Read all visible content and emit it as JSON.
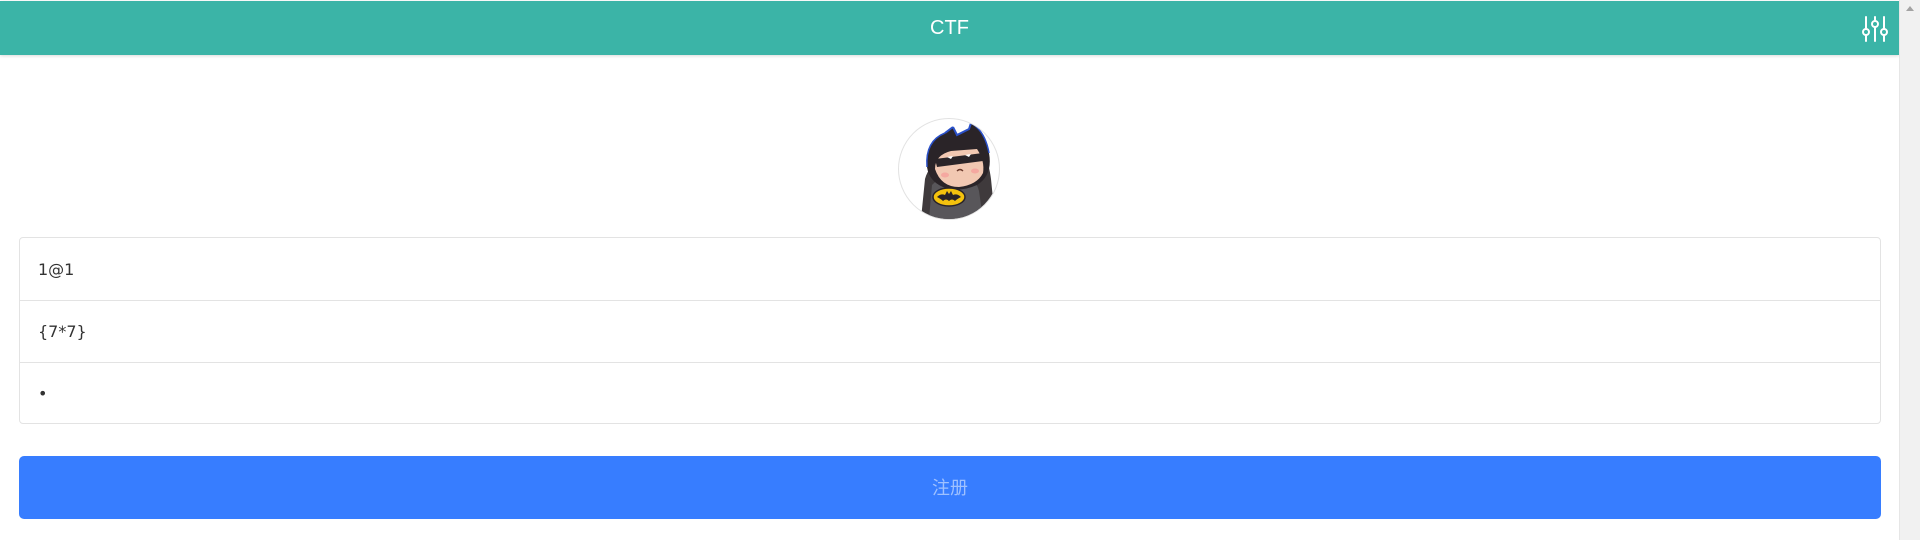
{
  "header": {
    "title": "CTF",
    "background_color": "#3bb4a7",
    "settings_icon": "sliders-icon"
  },
  "avatar": {
    "icon": "batman-avatar-icon"
  },
  "form": {
    "email_value": "1@1",
    "username_value": "{7*7}",
    "password_value": "1",
    "submit_label": "注册",
    "submit_color": "#377dff"
  },
  "scrollbar": {
    "icon": "scroll-up-arrow-icon"
  }
}
